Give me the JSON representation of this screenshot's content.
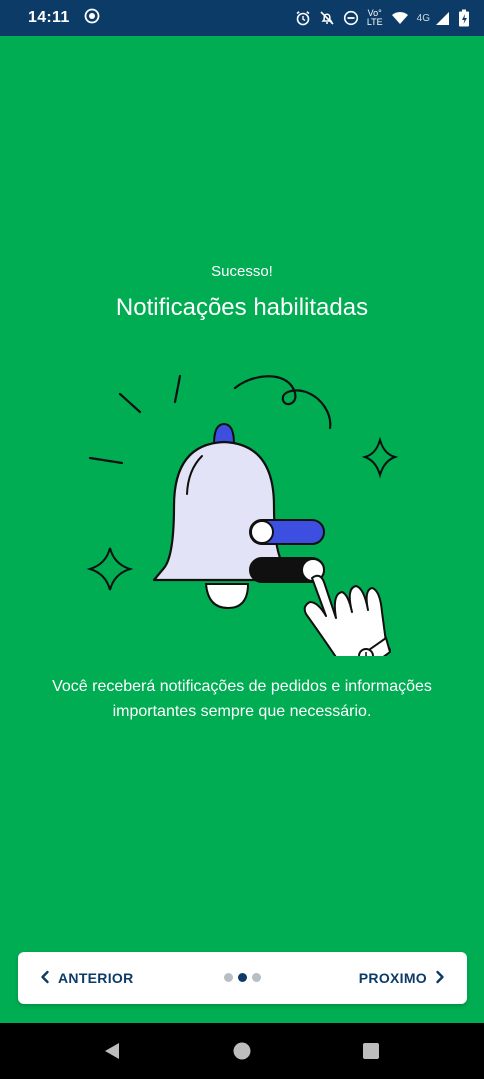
{
  "status_bar": {
    "time": "14:11",
    "volte_line1": "Vo°",
    "volte_line2": "LTE",
    "network": "4G",
    "icons": [
      "screen-record-icon",
      "alarm-icon",
      "mute-icon",
      "do-not-disturb-icon",
      "volte-icon",
      "wifi-icon",
      "signal-icon",
      "battery-charging-icon"
    ]
  },
  "main": {
    "subtitle": "Sucesso!",
    "title": "Notificações habilitadas",
    "description": "Você receberá notificações de pedidos e informações importantes sempre que necessário."
  },
  "pager": {
    "prev_label": "ANTERIOR",
    "next_label": "PROXIMO",
    "page_count": 3,
    "current_page": 2
  },
  "colors": {
    "background": "#00ad52",
    "status_bar": "#0b3b66",
    "nav_text": "#0b3b66",
    "bell_fill": "#e3e3f7",
    "toggle_blue": "#3d4fe0"
  },
  "system_nav": {
    "icons": [
      "back-icon",
      "home-icon",
      "recents-icon"
    ]
  }
}
